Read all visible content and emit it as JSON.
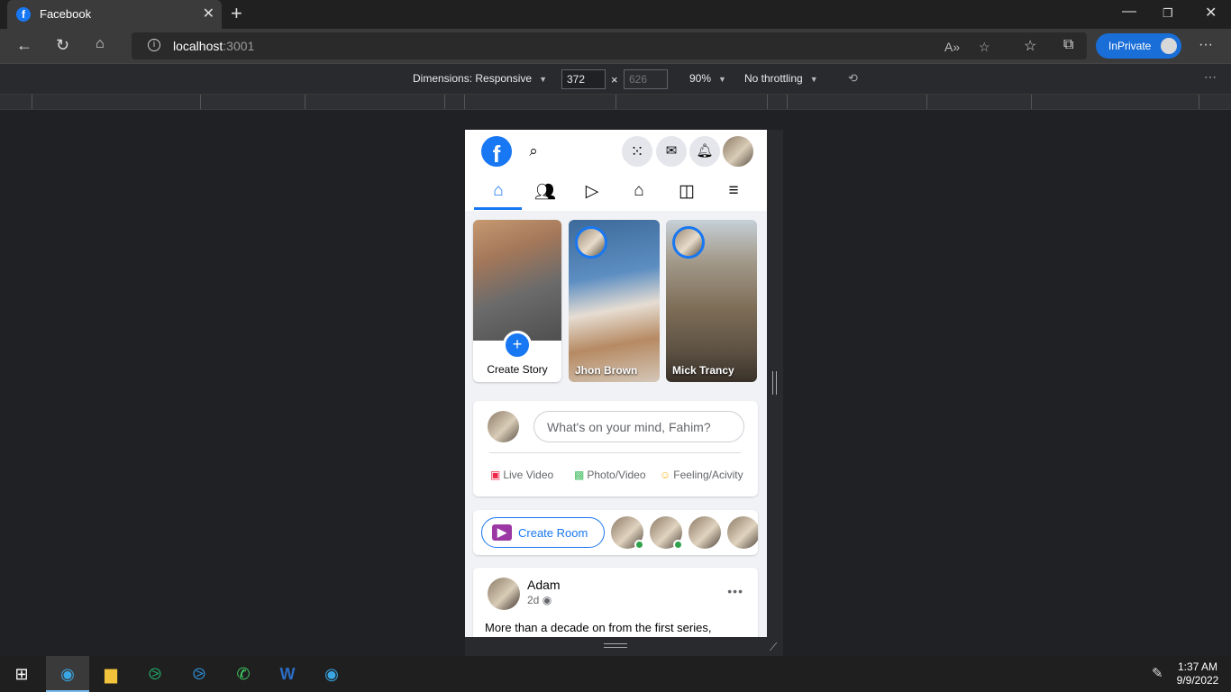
{
  "browser": {
    "tab_title": "Facebook",
    "tab_favicon": "f",
    "address_host": "localhost",
    "address_port": ":3001",
    "inprivate_label": "InPrivate"
  },
  "devtools": {
    "dimensions_label": "Dimensions: Responsive",
    "width": "372",
    "height": "626",
    "times": "×",
    "zoom": "90%",
    "throttling": "No throttling"
  },
  "facebook": {
    "logo": "f",
    "stories": [
      {
        "label": "Create Story",
        "plus": "+"
      },
      {
        "label": "Jhon Brown"
      },
      {
        "label": "Mick Trancy"
      }
    ],
    "composer": {
      "placeholder": "What's on your mind, Fahim?",
      "actions": [
        {
          "label": "Live Video",
          "icon": "live-video-icon",
          "color": "#f02849"
        },
        {
          "label": "Photo/Video",
          "icon": "photo-icon",
          "color": "#45bd62"
        },
        {
          "label": "Feeling/Acivity",
          "icon": "smile-icon",
          "color": "#f7b928"
        }
      ]
    },
    "rooms": {
      "button_label": "Create Room",
      "online_dot_color": "#31a24c"
    },
    "post": {
      "author": "Adam",
      "time": "2d",
      "more": "•••",
      "text": "More than a decade on from the first series,"
    },
    "accent_color": "#1877f2"
  },
  "taskbar": {
    "time": "1:37 AM",
    "date": "9/9/2022"
  }
}
